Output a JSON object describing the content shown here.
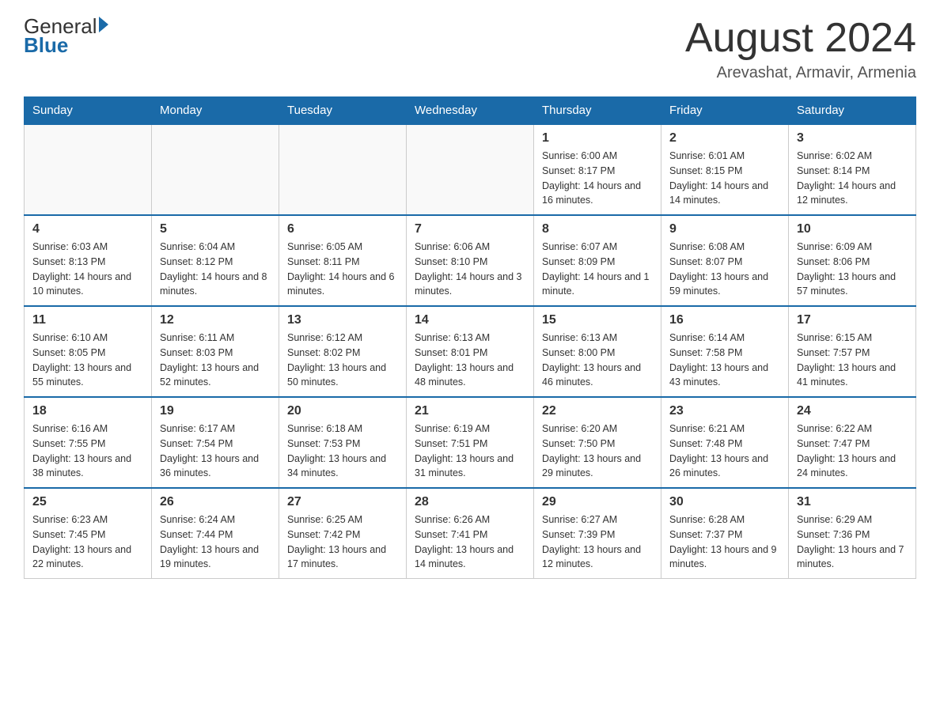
{
  "header": {
    "logo_text1": "General",
    "logo_text2": "Blue",
    "month_title": "August 2024",
    "location": "Arevashat, Armavir, Armenia"
  },
  "days_of_week": [
    "Sunday",
    "Monday",
    "Tuesday",
    "Wednesday",
    "Thursday",
    "Friday",
    "Saturday"
  ],
  "weeks": [
    [
      {
        "day": "",
        "info": ""
      },
      {
        "day": "",
        "info": ""
      },
      {
        "day": "",
        "info": ""
      },
      {
        "day": "",
        "info": ""
      },
      {
        "day": "1",
        "info": "Sunrise: 6:00 AM\nSunset: 8:17 PM\nDaylight: 14 hours and 16 minutes."
      },
      {
        "day": "2",
        "info": "Sunrise: 6:01 AM\nSunset: 8:15 PM\nDaylight: 14 hours and 14 minutes."
      },
      {
        "day": "3",
        "info": "Sunrise: 6:02 AM\nSunset: 8:14 PM\nDaylight: 14 hours and 12 minutes."
      }
    ],
    [
      {
        "day": "4",
        "info": "Sunrise: 6:03 AM\nSunset: 8:13 PM\nDaylight: 14 hours and 10 minutes."
      },
      {
        "day": "5",
        "info": "Sunrise: 6:04 AM\nSunset: 8:12 PM\nDaylight: 14 hours and 8 minutes."
      },
      {
        "day": "6",
        "info": "Sunrise: 6:05 AM\nSunset: 8:11 PM\nDaylight: 14 hours and 6 minutes."
      },
      {
        "day": "7",
        "info": "Sunrise: 6:06 AM\nSunset: 8:10 PM\nDaylight: 14 hours and 3 minutes."
      },
      {
        "day": "8",
        "info": "Sunrise: 6:07 AM\nSunset: 8:09 PM\nDaylight: 14 hours and 1 minute."
      },
      {
        "day": "9",
        "info": "Sunrise: 6:08 AM\nSunset: 8:07 PM\nDaylight: 13 hours and 59 minutes."
      },
      {
        "day": "10",
        "info": "Sunrise: 6:09 AM\nSunset: 8:06 PM\nDaylight: 13 hours and 57 minutes."
      }
    ],
    [
      {
        "day": "11",
        "info": "Sunrise: 6:10 AM\nSunset: 8:05 PM\nDaylight: 13 hours and 55 minutes."
      },
      {
        "day": "12",
        "info": "Sunrise: 6:11 AM\nSunset: 8:03 PM\nDaylight: 13 hours and 52 minutes."
      },
      {
        "day": "13",
        "info": "Sunrise: 6:12 AM\nSunset: 8:02 PM\nDaylight: 13 hours and 50 minutes."
      },
      {
        "day": "14",
        "info": "Sunrise: 6:13 AM\nSunset: 8:01 PM\nDaylight: 13 hours and 48 minutes."
      },
      {
        "day": "15",
        "info": "Sunrise: 6:13 AM\nSunset: 8:00 PM\nDaylight: 13 hours and 46 minutes."
      },
      {
        "day": "16",
        "info": "Sunrise: 6:14 AM\nSunset: 7:58 PM\nDaylight: 13 hours and 43 minutes."
      },
      {
        "day": "17",
        "info": "Sunrise: 6:15 AM\nSunset: 7:57 PM\nDaylight: 13 hours and 41 minutes."
      }
    ],
    [
      {
        "day": "18",
        "info": "Sunrise: 6:16 AM\nSunset: 7:55 PM\nDaylight: 13 hours and 38 minutes."
      },
      {
        "day": "19",
        "info": "Sunrise: 6:17 AM\nSunset: 7:54 PM\nDaylight: 13 hours and 36 minutes."
      },
      {
        "day": "20",
        "info": "Sunrise: 6:18 AM\nSunset: 7:53 PM\nDaylight: 13 hours and 34 minutes."
      },
      {
        "day": "21",
        "info": "Sunrise: 6:19 AM\nSunset: 7:51 PM\nDaylight: 13 hours and 31 minutes."
      },
      {
        "day": "22",
        "info": "Sunrise: 6:20 AM\nSunset: 7:50 PM\nDaylight: 13 hours and 29 minutes."
      },
      {
        "day": "23",
        "info": "Sunrise: 6:21 AM\nSunset: 7:48 PM\nDaylight: 13 hours and 26 minutes."
      },
      {
        "day": "24",
        "info": "Sunrise: 6:22 AM\nSunset: 7:47 PM\nDaylight: 13 hours and 24 minutes."
      }
    ],
    [
      {
        "day": "25",
        "info": "Sunrise: 6:23 AM\nSunset: 7:45 PM\nDaylight: 13 hours and 22 minutes."
      },
      {
        "day": "26",
        "info": "Sunrise: 6:24 AM\nSunset: 7:44 PM\nDaylight: 13 hours and 19 minutes."
      },
      {
        "day": "27",
        "info": "Sunrise: 6:25 AM\nSunset: 7:42 PM\nDaylight: 13 hours and 17 minutes."
      },
      {
        "day": "28",
        "info": "Sunrise: 6:26 AM\nSunset: 7:41 PM\nDaylight: 13 hours and 14 minutes."
      },
      {
        "day": "29",
        "info": "Sunrise: 6:27 AM\nSunset: 7:39 PM\nDaylight: 13 hours and 12 minutes."
      },
      {
        "day": "30",
        "info": "Sunrise: 6:28 AM\nSunset: 7:37 PM\nDaylight: 13 hours and 9 minutes."
      },
      {
        "day": "31",
        "info": "Sunrise: 6:29 AM\nSunset: 7:36 PM\nDaylight: 13 hours and 7 minutes."
      }
    ]
  ]
}
